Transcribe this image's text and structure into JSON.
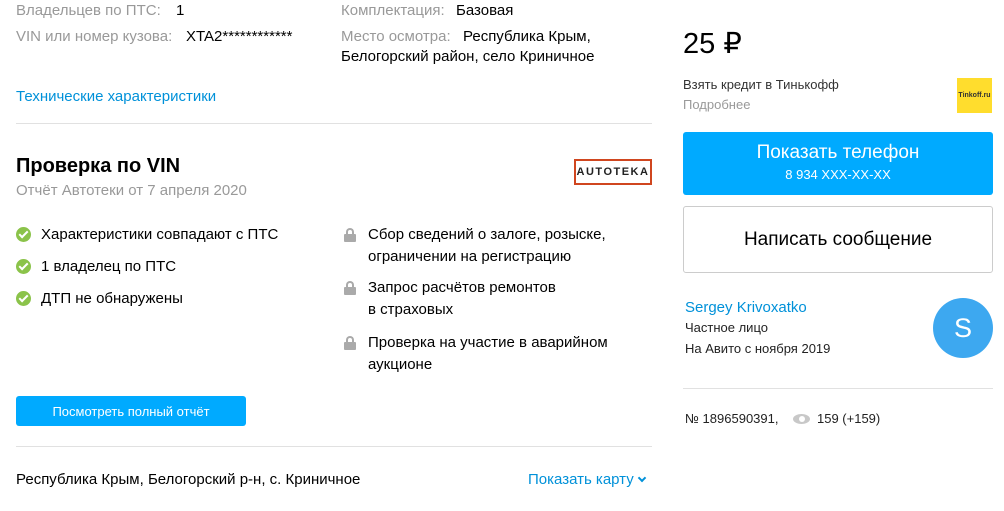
{
  "specs": {
    "owners_label": "Владельцев по ПТС:",
    "owners_value": "1",
    "vin_label": "VIN или номер кузова:",
    "vin_value": "XTA2************",
    "equipment_label": "Комплектация:",
    "equipment_value": "Базовая",
    "inspection_label": "Место осмотра:",
    "inspection_value_1": "Республика Крым,",
    "inspection_value_2": "Белогорский район, село Криничное",
    "tech_link": "Технические характеристики"
  },
  "vin_check": {
    "title": "Проверка по VIN",
    "subtitle": "Отчёт Автотеки от 7 апреля 2020",
    "logo_text": "AUTOTEKA",
    "passed": [
      "Характеристики совпадают с ПТС",
      "1 владелец по ПТС",
      "ДТП не обнаружены"
    ],
    "locked": [
      {
        "line1": "Сбор сведений о залоге, розыске,",
        "line2": "ограничении на регистрацию"
      },
      {
        "line1": "Запрос расчётов ремонтов",
        "line2": "в страховых"
      },
      {
        "line1": "Проверка на участие в аварийном",
        "line2": "аукционе"
      }
    ],
    "full_report_button": "Посмотреть полный отчёт"
  },
  "location": {
    "address": "Республика Крым, Белогорский р-н, с. Криничное",
    "map_link": "Показать карту"
  },
  "sidebar": {
    "price": "25 ₽",
    "credit_title": "Взять кредит в Тинькофф",
    "credit_more": "Подробнее",
    "tinkoff_logo_text": "Tinkoff.ru",
    "phone_button": "Показать телефон",
    "phone_number": "8 934 XXX-XX-XX",
    "message_button": "Написать сообщение",
    "seller_name": "Sergey Krivoxatko",
    "seller_type": "Частное лицо",
    "seller_since": "На Авито с ноября 2019",
    "avatar_letter": "S",
    "ad_number": "№ 1896590391,",
    "views": "159 (+159)"
  }
}
